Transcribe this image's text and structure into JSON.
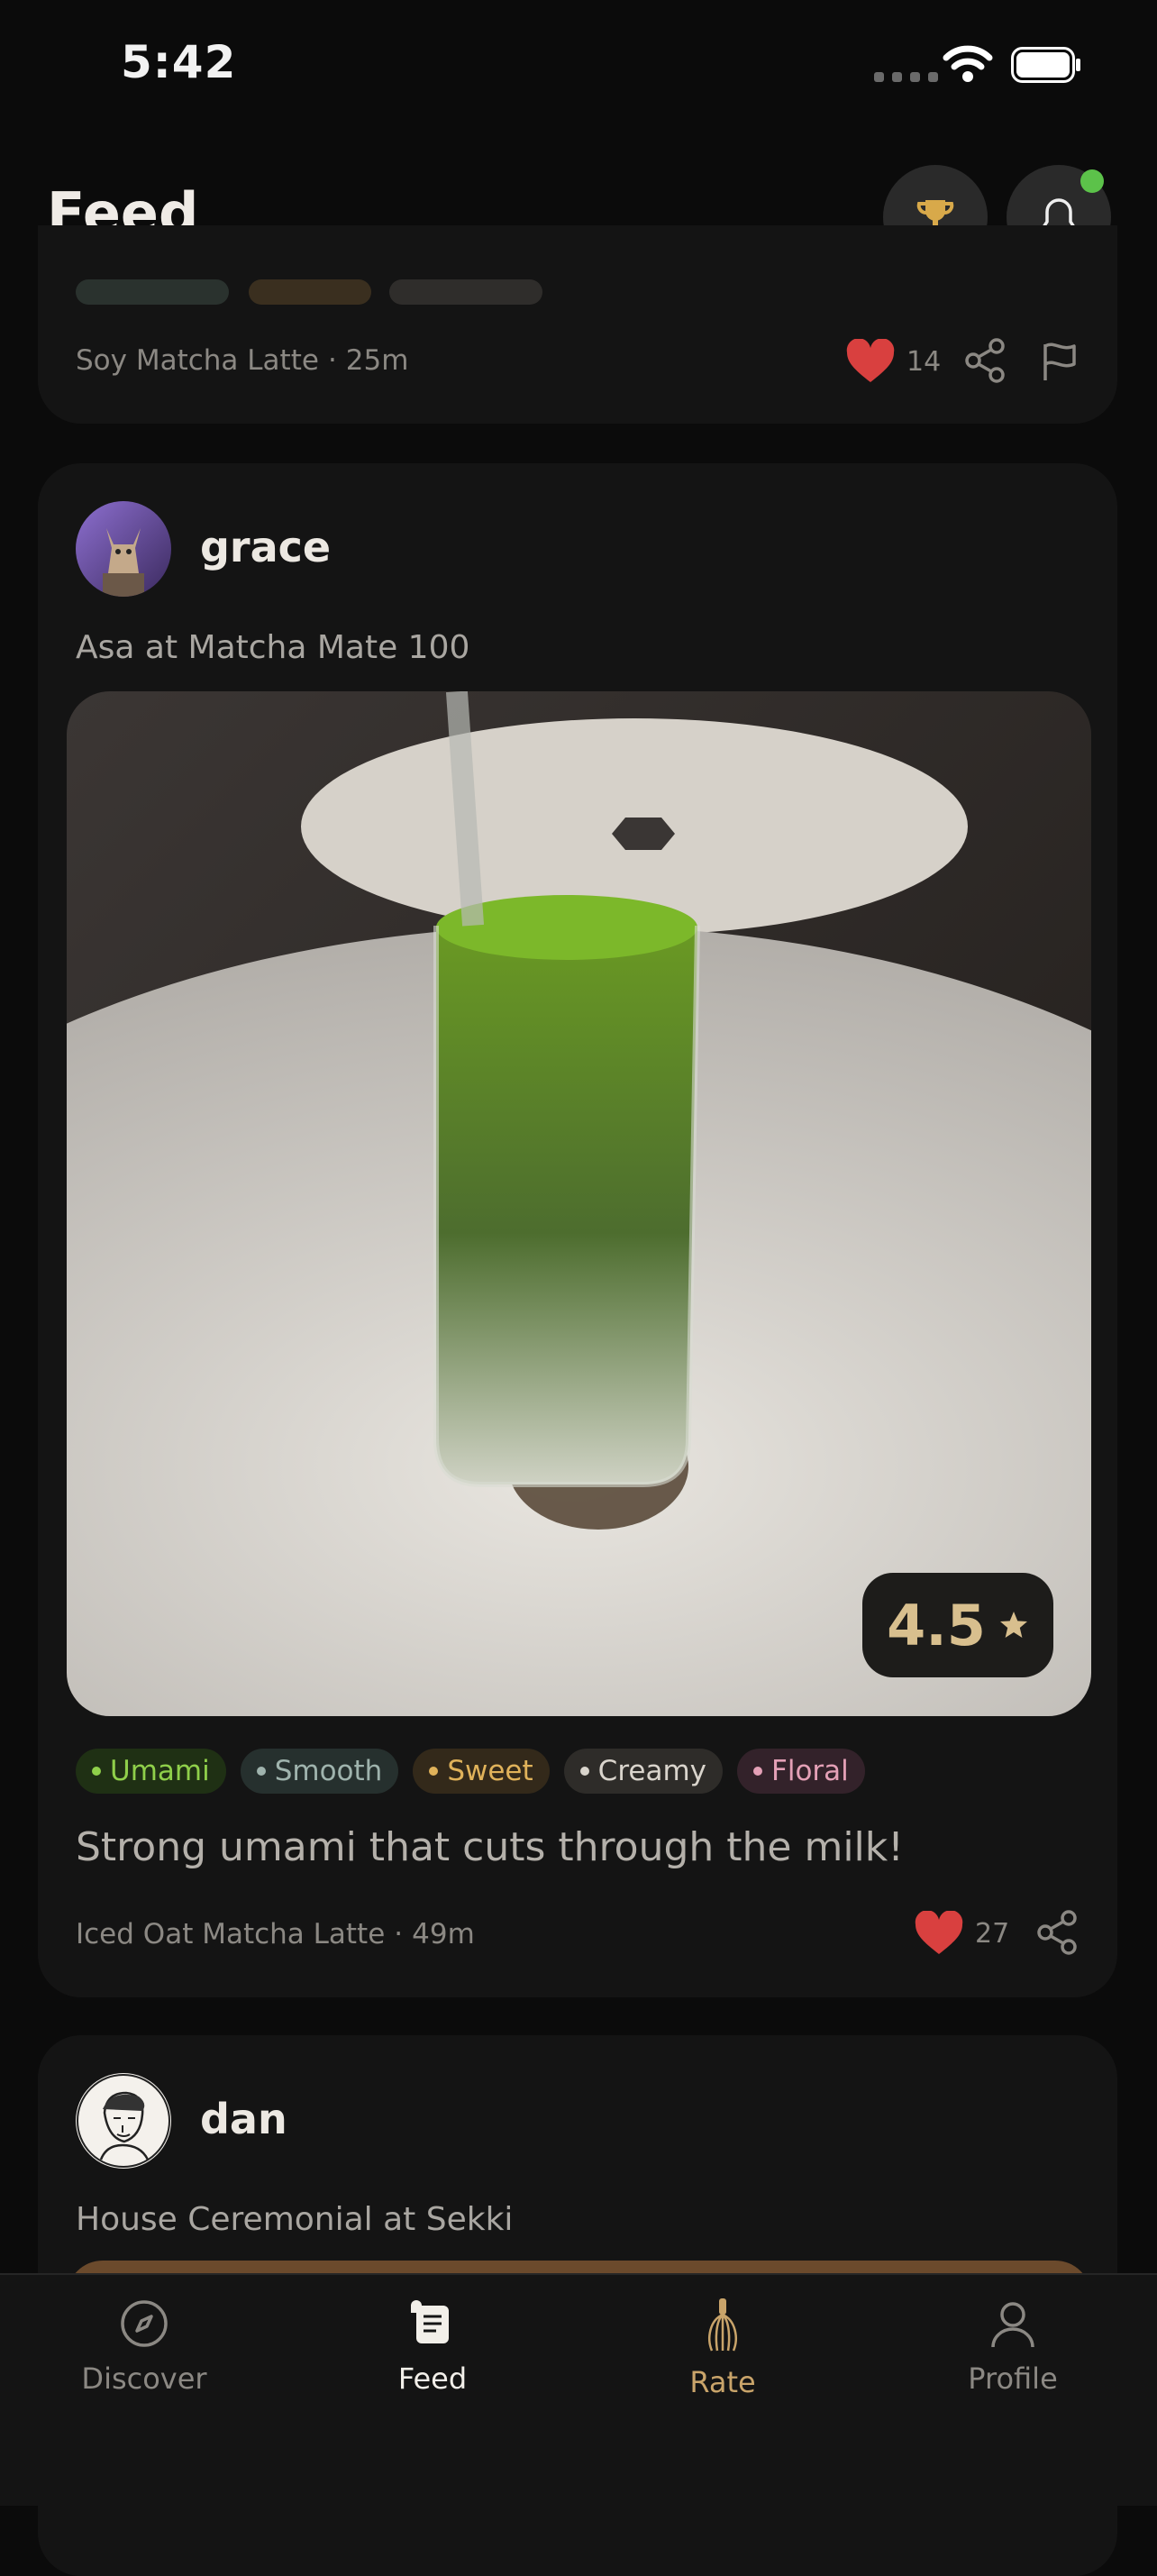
{
  "status_bar": {
    "time": "5:42"
  },
  "header": {
    "title": "Feed"
  },
  "previous_post": {
    "drink": "Soy Matcha Latte",
    "separator": "·",
    "age": "25m",
    "like_count": "14"
  },
  "posts": [
    {
      "username": "grace",
      "place": "Asa at Matcha Mate 100",
      "rating": "4.5",
      "tags": [
        {
          "label": "Umami",
          "text_color": "#8fcf4a",
          "bg": "#1f3014",
          "dot": "#8fcf4a"
        },
        {
          "label": "Smooth",
          "text_color": "#9fb3ad",
          "bg": "#26302e",
          "dot": "#9fb3ad"
        },
        {
          "label": "Sweet",
          "text_color": "#e0b25a",
          "bg": "#33291a",
          "dot": "#e0b25a"
        },
        {
          "label": "Creamy",
          "text_color": "#d9d4cc",
          "bg": "#2e2c29",
          "dot": "#d9d4cc"
        },
        {
          "label": "Floral",
          "text_color": "#e4a0b6",
          "bg": "#33222a",
          "dot": "#e4a0b6"
        }
      ],
      "review": "Strong umami that cuts through the milk!",
      "drink": "Iced Oat Matcha Latte",
      "separator": "·",
      "age": "49m",
      "like_count": "27"
    },
    {
      "username": "dan",
      "place": "House Ceremonial at Sekki"
    }
  ],
  "tab_bar": {
    "tabs": [
      {
        "label": "Discover",
        "icon": "compass-icon"
      },
      {
        "label": "Feed",
        "icon": "scroll-icon"
      },
      {
        "label": "Rate",
        "icon": "whisk-icon"
      },
      {
        "label": "Profile",
        "icon": "person-icon"
      }
    ]
  },
  "colors": {
    "accent_gold": "#d8a94a",
    "like_red": "#d9403f",
    "online_green": "#5cc24a",
    "active_tab": "#f2efe9",
    "rate_tab": "#c9a46a",
    "inactive_tab": "#8b8883"
  }
}
